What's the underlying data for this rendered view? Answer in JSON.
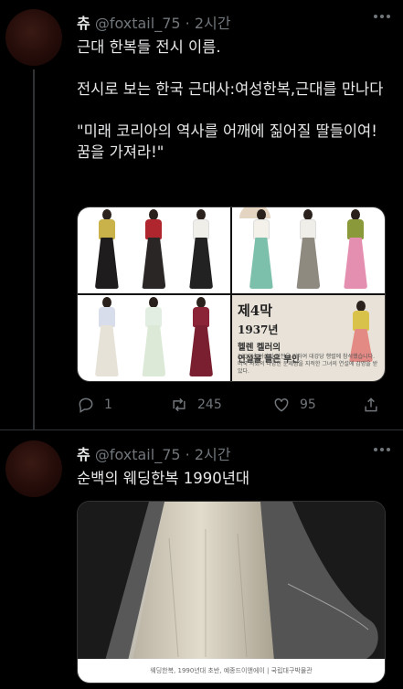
{
  "tweets": [
    {
      "display_name": "츄",
      "handle": "@foxtail_75",
      "separator": "·",
      "time": "2시간",
      "text": "근대 한복들 전시 이름.\n\n전시로 보는 한국 근대사:여성한복,근대를 만나다\n\n\"미래 코리아의 역사를 어깨에 짊어질 딸들이여! 꿈을 가져라!\"",
      "poster": {
        "act": "제4막",
        "year": "1937년",
        "subtitle_line1": "헬렌 켈러의",
        "subtitle_line2": "연설을 들은 부인",
        "body": "1937년 여성의 발전을 위하여 대강당 행렬에 참석했습니다. 미국 사회의 다양한 문제점을 지적한 그녀의 연설에 감명을 받았다."
      },
      "stats": {
        "replies": "1",
        "retweets": "245",
        "likes": "95"
      }
    },
    {
      "display_name": "츄",
      "handle": "@foxtail_75",
      "separator": "·",
      "time": "2시간",
      "text": "순백의 웨딩한복 1990년대",
      "caption": "웨딩한복, 1990년대 초반, 예종드이앤에이 | 국립대구박물관"
    }
  ],
  "colors": {
    "background": "#000000",
    "text": "#e7e9ea",
    "muted": "#71767b",
    "border": "#2f3336"
  }
}
